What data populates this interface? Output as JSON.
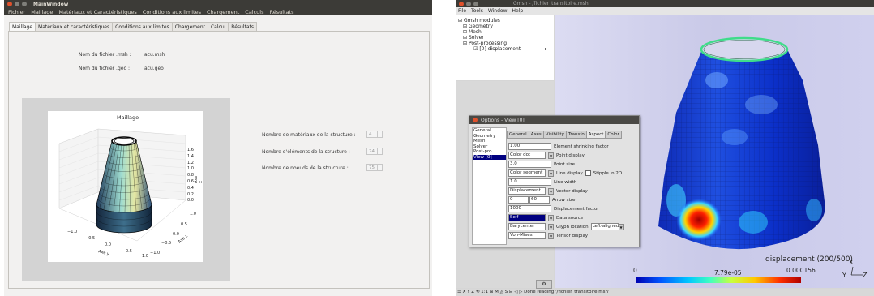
{
  "left_window": {
    "title": "MainWindow",
    "menu": [
      "Fichier",
      "Maillage",
      "Matériaux et Caractéristiques",
      "Conditions aux limites",
      "Chargement",
      "Calculs",
      "Résultats"
    ],
    "tabs": [
      "Maillage",
      "Matériaux et caractéristiques",
      "Conditions aux limites",
      "Chargement",
      "Calcul",
      "Résultats"
    ],
    "active_tab": "Maillage",
    "msh_label": "Nom du fichier .msh :",
    "msh_value": "acu.msh",
    "geo_label": "Nom du fichier .geo :",
    "geo_value": "acu.geo",
    "plot": {
      "title": "Maillage",
      "xlabel": "Axe y",
      "ylabel": "Axe z",
      "zlabel": "Axe x",
      "x_ticks": [
        "−1.0",
        "−0.5",
        "0.0",
        "0.5",
        "1.0"
      ],
      "y_ticks": [
        "1.0",
        "0.5",
        "0.0",
        "−0.5",
        "−1.0"
      ],
      "z_ticks": [
        "1.6",
        "1.4",
        "1.2",
        "1.0",
        "0.8",
        "0.6",
        "0.4",
        "0.2",
        "0.0"
      ]
    },
    "materials_label": "Nombre de matériaux de la structure :",
    "materials_value": "4",
    "elements_label": "Nombre d'éléments de la structure :",
    "elements_value": "74",
    "nodes_label": "Nombre de noeuds de la structure :",
    "nodes_value": "75"
  },
  "right_window": {
    "title": "Gmsh - /fichier_transitoire.msh",
    "menu": [
      "File",
      "Tools",
      "Window",
      "Help"
    ],
    "tree": {
      "root": "Gmsh modules",
      "items": [
        "Geometry",
        "Mesh",
        "Solver",
        "Post-processing"
      ],
      "view": "[0] displacement"
    },
    "dialog": {
      "title": "Options - View [0]",
      "categories": [
        "General",
        "Geometry",
        "Mesh",
        "Solver",
        "Post-pro",
        "View [0]"
      ],
      "selected_category": "View [0]",
      "tabs": [
        "General",
        "Axes",
        "Visibility",
        "Transfo",
        "Aspect",
        "Color"
      ],
      "active_tab": "Aspect",
      "rows": {
        "shrink_value": "1.00",
        "shrink_label": "Element shrinking factor",
        "point_display_value": "Color dot",
        "point_display_label": "Point display",
        "point_size_value": "3.0",
        "point_size_label": "Point size",
        "line_display_value": "Color segment",
        "line_display_label": "Line display",
        "stipple_label": "Stipple in 2D",
        "line_width_value": "1.0",
        "line_width_label": "Line width",
        "vector_display_value": "Displacement",
        "vector_display_label": "Vector display",
        "arrow_size_a": "0",
        "arrow_size_b": "60",
        "arrow_size_label": "Arrow size",
        "disp_factor_value": "1000",
        "disp_factor_label": "Displacement factor",
        "data_source_value": "Self",
        "data_source_label": "Data source",
        "glyph_value": "Barycenter",
        "glyph_label": "Glyph location",
        "glyph_align_value": "Left-aligned",
        "tensor_value": "Von-Mises",
        "tensor_label": "Tensor display"
      }
    },
    "scale": {
      "title": "displacement (200/500)",
      "min": "0",
      "mid": "7.79e-05",
      "max": "0.000156"
    },
    "axes": {
      "x": "X",
      "y": "Y",
      "z": "Z"
    },
    "status_icons": "☰ X Y Z ⟲ 1:1 ⊞ M ◬ S ⊟ ◁ ▷",
    "status_text": "Done reading '/fichier_transitoire.msh'"
  },
  "colors": {
    "ubuntu_titlebar": "#3c3b37",
    "close_red": "#e0512c",
    "selection_blue": "#000080",
    "mesh_outline_green": "#3fdc8a"
  }
}
